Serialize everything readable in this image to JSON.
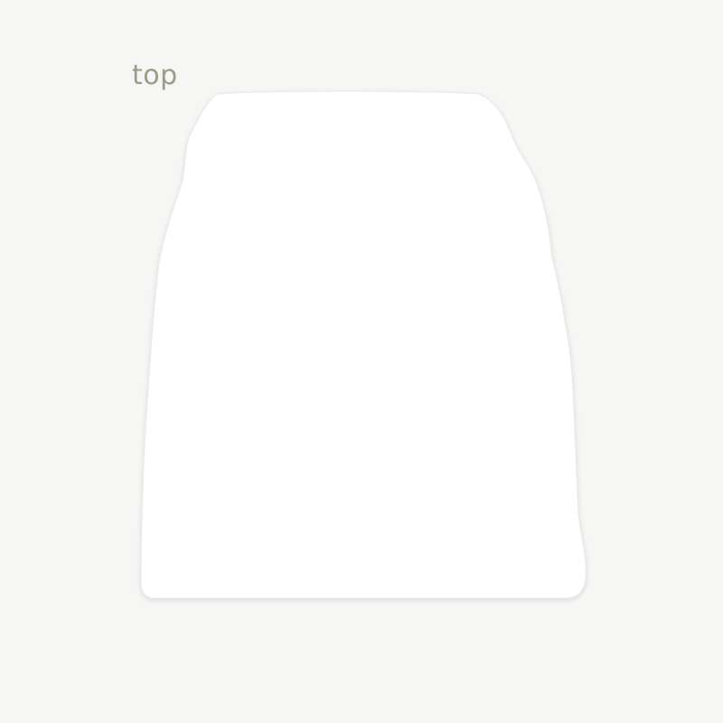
{
  "label": {
    "text": "top",
    "color": "#9a9c85"
  },
  "garment": {
    "name": "top",
    "fill": "#ffffff",
    "shadow": "#e9e9e6"
  },
  "background": {
    "color": "#f6f6f4"
  }
}
